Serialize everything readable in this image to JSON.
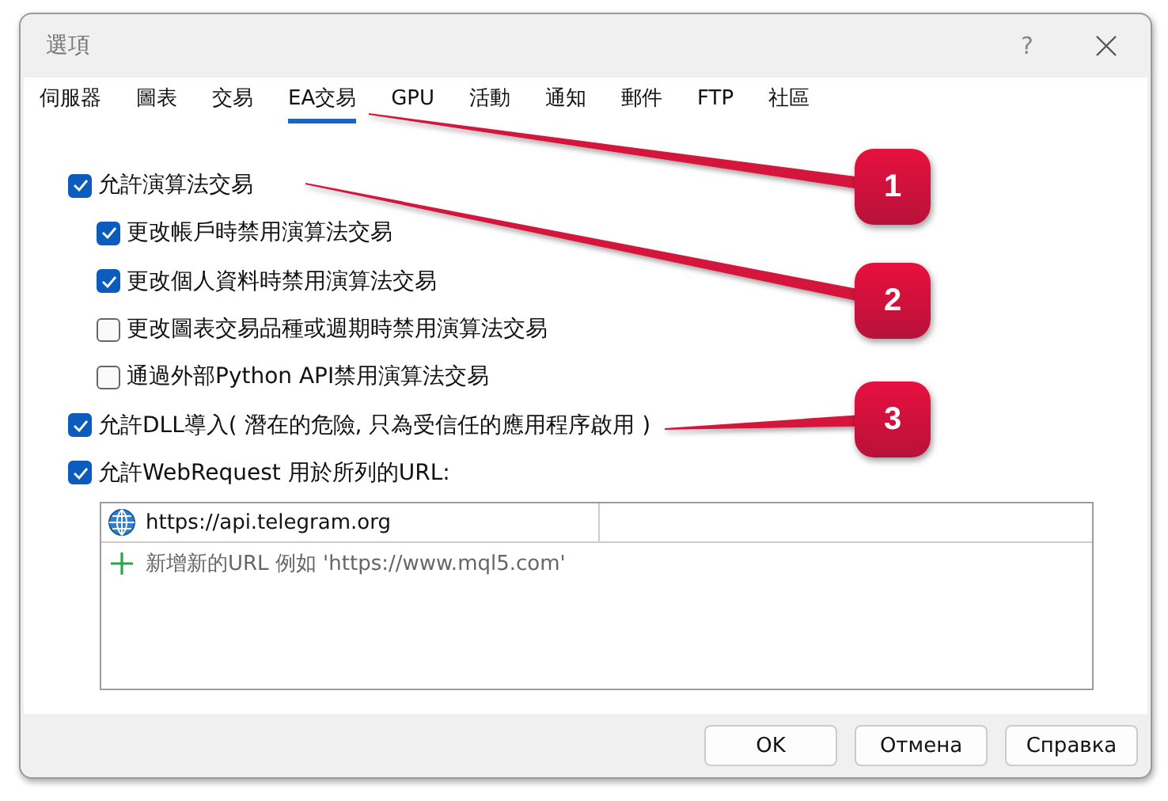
{
  "window": {
    "title": "選項",
    "help": "?"
  },
  "tabs": [
    {
      "label": "伺服器",
      "selected": false
    },
    {
      "label": "圖表",
      "selected": false
    },
    {
      "label": "交易",
      "selected": false
    },
    {
      "label": "EA交易",
      "selected": true
    },
    {
      "label": "GPU",
      "selected": false
    },
    {
      "label": "活動",
      "selected": false
    },
    {
      "label": "通知",
      "selected": false
    },
    {
      "label": "郵件",
      "selected": false
    },
    {
      "label": "FTP",
      "selected": false
    },
    {
      "label": "社區",
      "selected": false
    }
  ],
  "options": [
    {
      "label": "允許演算法交易",
      "checked": true,
      "children": [
        {
          "label": "更改帳戶時禁用演算法交易",
          "checked": true
        },
        {
          "label": "更改個人資料時禁用演算法交易",
          "checked": true
        },
        {
          "label": "更改圖表交易品種或週期時禁用演算法交易",
          "checked": false
        },
        {
          "label": "通過外部Python API禁用演算法交易",
          "checked": false
        }
      ]
    },
    {
      "label": "允許DLL導入( 潛在的危險, 只為受信任的應用程序啟用 )",
      "checked": true
    },
    {
      "label": "允許WebRequest 用於所列的URL:",
      "checked": true
    }
  ],
  "url_list": {
    "rows": [
      "https://api.telegram.org"
    ],
    "add_placeholder": "新增新的URL 例如 'https://www.mql5.com'"
  },
  "buttons": [
    "OK",
    "Отмена",
    "Справка"
  ],
  "callouts": [
    "1",
    "2",
    "3"
  ]
}
